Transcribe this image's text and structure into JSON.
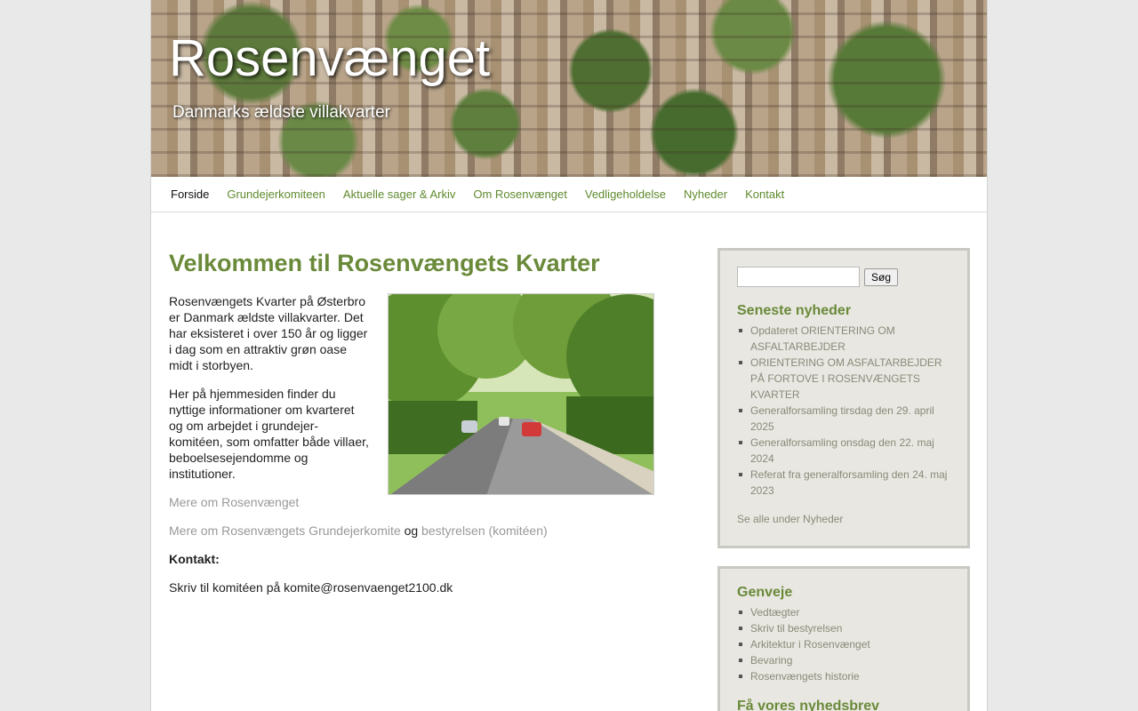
{
  "header": {
    "title": "Rosenvænget",
    "description": "Danmarks ældste villakvarter"
  },
  "nav": {
    "items": [
      {
        "label": "Forside"
      },
      {
        "label": "Grundejerkomiteen"
      },
      {
        "label": "Aktuelle sager & Arkiv"
      },
      {
        "label": "Om Rosenvænget"
      },
      {
        "label": "Vedligeholdelse"
      },
      {
        "label": "Nyheder"
      },
      {
        "label": "Kontakt"
      }
    ]
  },
  "main": {
    "title": "Velkommen til Rosenvængets Kvarter",
    "p1": "Rosenvængets Kvarter på Østerbro er Danmark ældste villakvarter. Det har eksisteret i over 150 år og ligger i dag som en attraktiv grøn oase midt i storbyen.",
    "p2": "Her på hjemmesiden finder du nyttige informationer om kvarteret og om arbejdet i grundejer-komitéen, som omfatter både villaer, beboelsesejendomme og institutioner.",
    "link1": "Mere om Rosenvænget",
    "link2": "Mere om Rosenvængets Grundejerkomite",
    "og": "og",
    "link3": "bestyrelsen (komitéen)",
    "contact_label": "Kontakt:",
    "contact_text": "Skriv til komitéen på komite@rosenvaenget2100.dk"
  },
  "sidebar": {
    "search_button": "Søg",
    "news_title": "Seneste nyheder",
    "news": [
      {
        "label": "Opdateret ORIENTERING OM ASFALTARBEJDER"
      },
      {
        "label": "ORIENTERING OM ASFALTARBEJDER PÅ FORTOVE I ROSENVÆNGETS KVARTER"
      },
      {
        "label": "Generalforsamling tirsdag den 29. april 2025"
      },
      {
        "label": "Generalforsamling onsdag den 22. maj 2024"
      },
      {
        "label": "Referat fra generalforsamling den 24. maj 2023"
      }
    ],
    "see_all": "Se alle under Nyheder",
    "shortcuts_title": "Genveje",
    "shortcuts": [
      {
        "label": "Vedtægter"
      },
      {
        "label": "Skriv til bestyrelsen"
      },
      {
        "label": "Arkitektur i Rosenvænget"
      },
      {
        "label": "Bevaring"
      },
      {
        "label": "Rosenvængets historie"
      }
    ],
    "newsletter_title": "Få vores nyhedsbrev"
  }
}
